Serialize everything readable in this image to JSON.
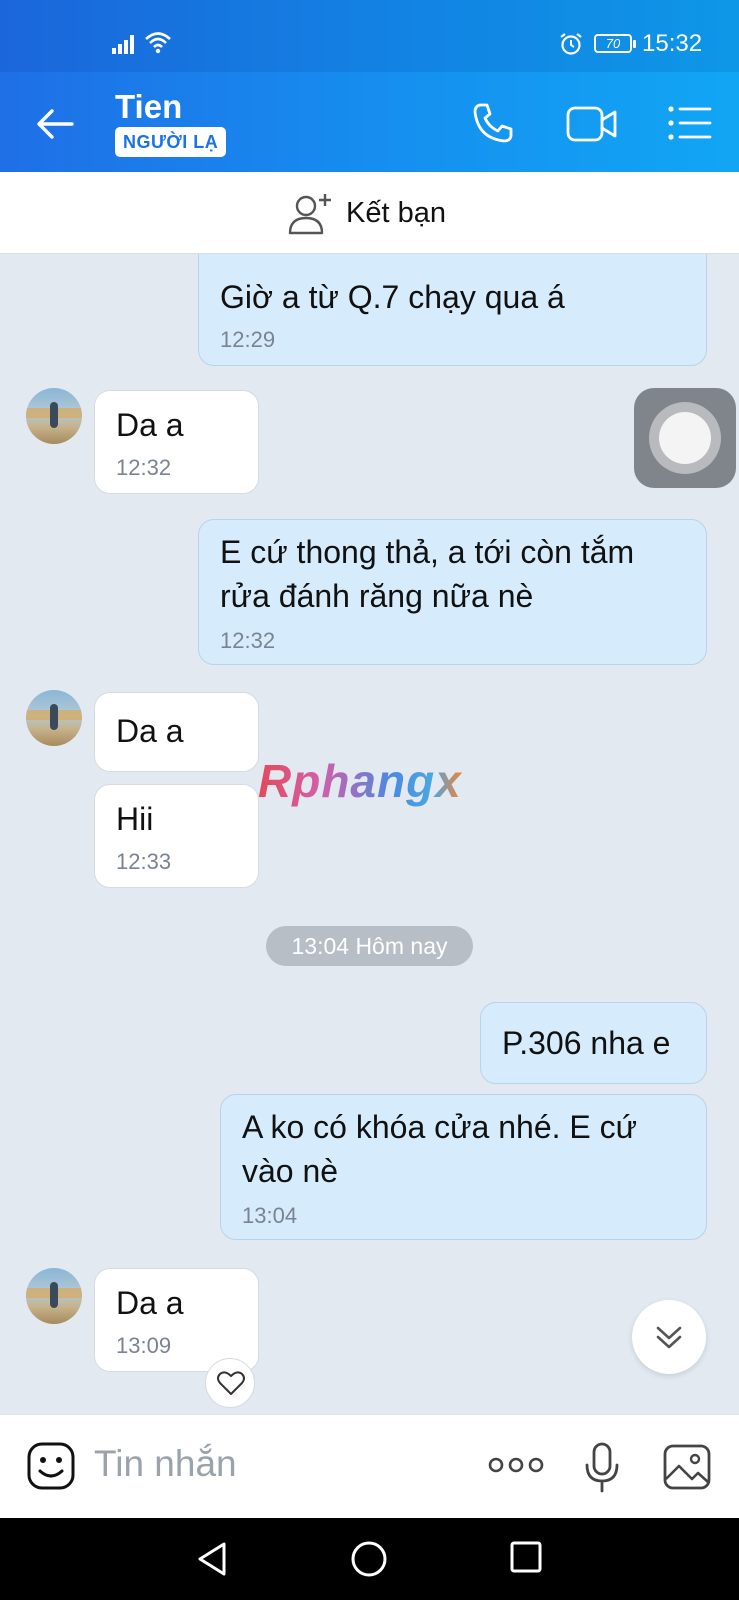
{
  "status_bar": {
    "time": "15:32",
    "battery": "70"
  },
  "header": {
    "contact_name": "Tien",
    "badge": "NGƯỜI LẠ",
    "icons": [
      "back-arrow-icon",
      "phone-icon",
      "video-call-icon",
      "menu-list-icon"
    ]
  },
  "friend_bar": {
    "label": "Kết bạn",
    "icon": "add-friend-icon"
  },
  "messages": [
    {
      "direction": "out",
      "text_lines": [
        "Giờ a từ Q.7 chạy qua á"
      ],
      "time": "12:29"
    },
    {
      "direction": "in",
      "text_lines": [
        "Da a"
      ],
      "time": "12:32"
    },
    {
      "direction": "out",
      "text_lines": [
        "E cứ thong thả, a tới còn tắm",
        "rửa đánh răng nữa nè"
      ],
      "time": "12:32"
    },
    {
      "direction": "in",
      "text_lines": [
        "Da a"
      ],
      "time": ""
    },
    {
      "direction": "in",
      "text_lines": [
        "Hii"
      ],
      "time": "12:33"
    },
    {
      "direction": "out",
      "text_lines": [
        "P.306 nha e"
      ],
      "time": ""
    },
    {
      "direction": "out",
      "text_lines": [
        "A ko có khóa cửa nhé. E cứ",
        "vào nè"
      ],
      "time": "13:04"
    },
    {
      "direction": "in",
      "text_lines": [
        "Da a"
      ],
      "time": "13:09"
    }
  ],
  "date_separator": "13:04 Hôm nay",
  "watermark": "Rphangx",
  "input": {
    "placeholder": "Tin nhắn"
  },
  "accent_color": "#1a86ee"
}
